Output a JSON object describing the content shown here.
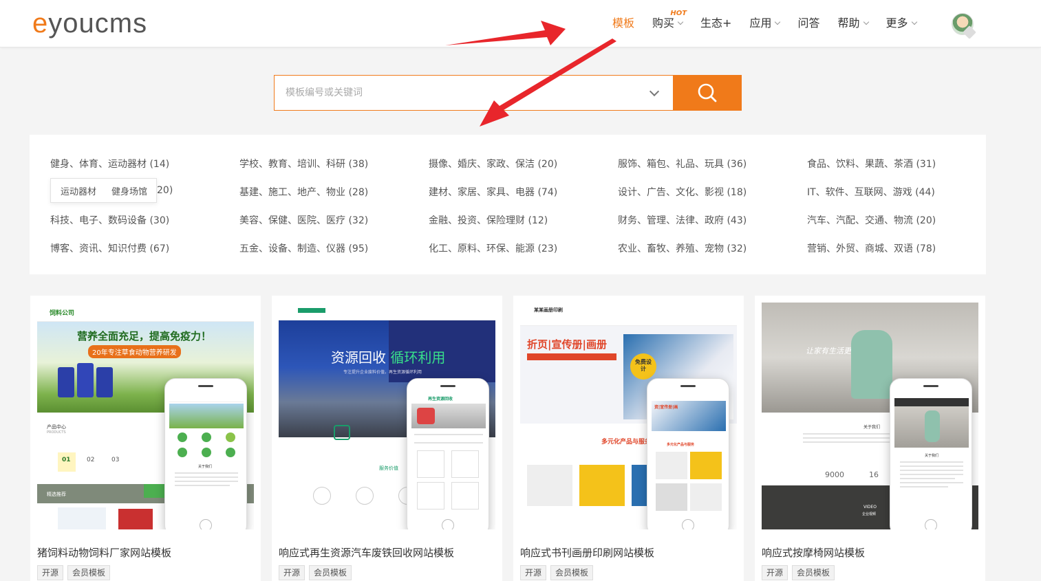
{
  "brand": {
    "logo_prefix": "e",
    "logo_suffix": "youcms",
    "accent": "#f07a1a"
  },
  "nav": {
    "items": [
      {
        "label": "模板",
        "active": true
      },
      {
        "label": "购买",
        "dropdown": true,
        "badge": "HOT"
      },
      {
        "label": "生态+"
      },
      {
        "label": "应用",
        "dropdown": true
      },
      {
        "label": "问答"
      },
      {
        "label": "帮助",
        "dropdown": true
      },
      {
        "label": "更多",
        "dropdown": true
      }
    ]
  },
  "search": {
    "placeholder": "模板编号或关键词",
    "icon": "search-icon"
  },
  "categories": [
    [
      "健身、体育、运动器材 (14)",
      "学校、教育、培训、科研 (38)",
      "摄像、婚庆、家政、保洁 (20)",
      "服饰、箱包、礼品、玩具 (36)",
      "食品、饮料、果蔬、茶酒 (31)"
    ],
    [
      "运动器材 健身场馆 20)",
      "基建、施工、地产、物业 (28)",
      "建材、家居、家具、电器 (74)",
      "设计、广告、文化、影视 (18)",
      "IT、软件、互联网、游戏 (44)"
    ],
    [
      "科技、电子、数码设备 (30)",
      "美容、保健、医院、医疗 (32)",
      "金融、投资、保险理财 (12)",
      "财务、管理、法律、政府 (43)",
      "汽车、汽配、交通、物流 (20)"
    ],
    [
      "博客、资讯、知识付费 (67)",
      "五金、设备、制造、仪器 (95)",
      "化工、原料、环保、能源 (23)",
      "农业、畜牧、养殖、宠物 (32)",
      "营销、外贸、商城、双语 (78)"
    ]
  ],
  "subcategory_popup": {
    "items": [
      "运动器材",
      "健身场馆"
    ],
    "overlap_text": "20)"
  },
  "cards": [
    {
      "title": "猪饲料动物饲料厂家网站模板",
      "tags": [
        "开源",
        "会员模板"
      ],
      "preview": {
        "company": "饲料公司",
        "headline": "营养全面充足，提高免疫力！",
        "subhead": "20年专注草食动物营养研发",
        "section": "产品中心",
        "section_en": "PRODUCTS",
        "nums": [
          "01",
          "02",
          "03"
        ],
        "recommend": "精选推荐",
        "phone_about": "关于我们"
      }
    },
    {
      "title": "响应式再生资源汽车废铁回收网站模板",
      "tags": [
        "开源",
        "会员模板"
      ],
      "preview": {
        "headline_a": "资源回收",
        "headline_b": "循环利用",
        "subhead": "专注提升企业废料价值，再生资源循环利用",
        "service": "服务价值",
        "phone_brand": "再生资源回收"
      }
    },
    {
      "title": "响应式书刊画册印刷网站模板",
      "tags": [
        "开源",
        "会员模板"
      ],
      "preview": {
        "company": "某某画册印刷",
        "headline": "折页|宣传册|画册",
        "badge": "免费设计",
        "multi": "多元化产品与服务",
        "phone_multi": "多元化产品与服务",
        "phone_headline": "资|宣传册|画"
      }
    },
    {
      "title": "响应式按摩椅网站模板",
      "tags": [
        "开源",
        "会员模板"
      ],
      "preview": {
        "slogan": "让家有生活更美好",
        "about": "关于我们",
        "stat_a": "9000",
        "stat_b": "16",
        "video": "VIDEO",
        "video_cn": "企业视频",
        "phone_about": "关于我们"
      }
    }
  ]
}
